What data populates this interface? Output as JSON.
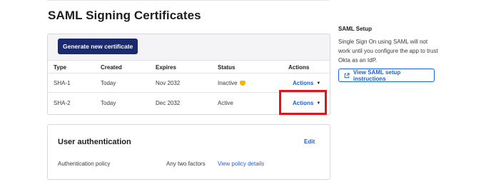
{
  "header": {
    "title": "SAML Signing Certificates"
  },
  "certificates": {
    "generate_button": "Generate new certificate",
    "columns": [
      "Type",
      "Created",
      "Expires",
      "Status",
      "Actions"
    ],
    "rows": [
      {
        "type": "SHA-1",
        "created": "Today",
        "expires": "Nov 2032",
        "status": "Inactive",
        "status_icon": "warning-icon",
        "actions": "Actions"
      },
      {
        "type": "SHA-2",
        "created": "Today",
        "expires": "Dec 2032",
        "status": "Active",
        "actions": "Actions"
      }
    ]
  },
  "auth": {
    "title": "User authentication",
    "edit": "Edit",
    "policy_label": "Authentication policy",
    "policy_value": "Any two factors",
    "policy_link": "View policy details"
  },
  "sidebar": {
    "title": "SAML Setup",
    "text": "Single Sign On using SAML will not work until you configure the app to trust Okta as an IdP.",
    "button": "View SAML setup instructions",
    "button_icon": "external-link-icon"
  },
  "colors": {
    "primary_button": "#1a2a6c",
    "link": "#1662dd",
    "highlight": "#e0141d",
    "warning": "#f2b705"
  }
}
